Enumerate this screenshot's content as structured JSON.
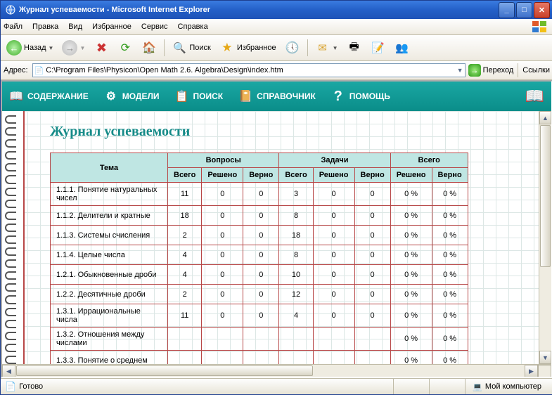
{
  "window": {
    "title": "Журнал успеваемости - Microsoft Internet Explorer"
  },
  "menu": {
    "file": "Файл",
    "edit": "Правка",
    "view": "Вид",
    "favorites": "Избранное",
    "tools": "Сервис",
    "help": "Справка"
  },
  "toolbar": {
    "back": "Назад",
    "search": "Поиск",
    "favorites": "Избранное"
  },
  "address": {
    "label": "Адрес:",
    "path": "C:\\Program Files\\Physicon\\Open Math 2.6. Algebra\\Design\\index.htm",
    "go": "Переход",
    "links": "Ссылки"
  },
  "appnav": {
    "contents": "СОДЕРЖАНИЕ",
    "models": "МОДЕЛИ",
    "search": "ПОИСК",
    "reference": "СПРАВОЧНИК",
    "help": "ПОМОЩЬ"
  },
  "page": {
    "title": "Журнал успеваемости"
  },
  "table": {
    "h_topic": "Тема",
    "h_questions": "Вопросы",
    "h_tasks": "Задачи",
    "h_total": "Всего",
    "h_all": "Всего",
    "h_solved": "Решено",
    "h_correct": "Верно",
    "rows": [
      {
        "topic": "1.1.1. Понятие натуральных чисел",
        "q_all": "11",
        "q_s": "0",
        "q_c": "0",
        "t_all": "3",
        "t_s": "0",
        "t_c": "0",
        "tot_s": "0 %",
        "tot_c": "0 %"
      },
      {
        "topic": "1.1.2. Делители и кратные",
        "q_all": "18",
        "q_s": "0",
        "q_c": "0",
        "t_all": "8",
        "t_s": "0",
        "t_c": "0",
        "tot_s": "0 %",
        "tot_c": "0 %"
      },
      {
        "topic": "1.1.3. Системы счисления",
        "q_all": "2",
        "q_s": "0",
        "q_c": "0",
        "t_all": "18",
        "t_s": "0",
        "t_c": "0",
        "tot_s": "0 %",
        "tot_c": "0 %"
      },
      {
        "topic": "1.1.4. Целые числа",
        "q_all": "4",
        "q_s": "0",
        "q_c": "0",
        "t_all": "8",
        "t_s": "0",
        "t_c": "0",
        "tot_s": "0 %",
        "tot_c": "0 %"
      },
      {
        "topic": "1.2.1. Обыкновенные дроби",
        "q_all": "4",
        "q_s": "0",
        "q_c": "0",
        "t_all": "10",
        "t_s": "0",
        "t_c": "0",
        "tot_s": "0 %",
        "tot_c": "0 %"
      },
      {
        "topic": "1.2.2. Десятичные дроби",
        "q_all": "2",
        "q_s": "0",
        "q_c": "0",
        "t_all": "12",
        "t_s": "0",
        "t_c": "0",
        "tot_s": "0 %",
        "tot_c": "0 %"
      },
      {
        "topic": "1.3.1. Иррациональные числа",
        "q_all": "11",
        "q_s": "0",
        "q_c": "0",
        "t_all": "4",
        "t_s": "0",
        "t_c": "0",
        "tot_s": "0 %",
        "tot_c": "0 %"
      },
      {
        "topic": "1.3.2. Отношения между числами",
        "q_all": "",
        "q_s": "",
        "q_c": "",
        "t_all": "",
        "t_s": "",
        "t_c": "",
        "tot_s": "0 %",
        "tot_c": "0 %"
      },
      {
        "topic": "1.3.3. Понятие о среднем",
        "q_all": "",
        "q_s": "",
        "q_c": "",
        "t_all": "",
        "t_s": "",
        "t_c": "",
        "tot_s": "0 %",
        "tot_c": "0 %"
      }
    ]
  },
  "status": {
    "ready": "Готово",
    "zone": "Мой компьютер"
  }
}
